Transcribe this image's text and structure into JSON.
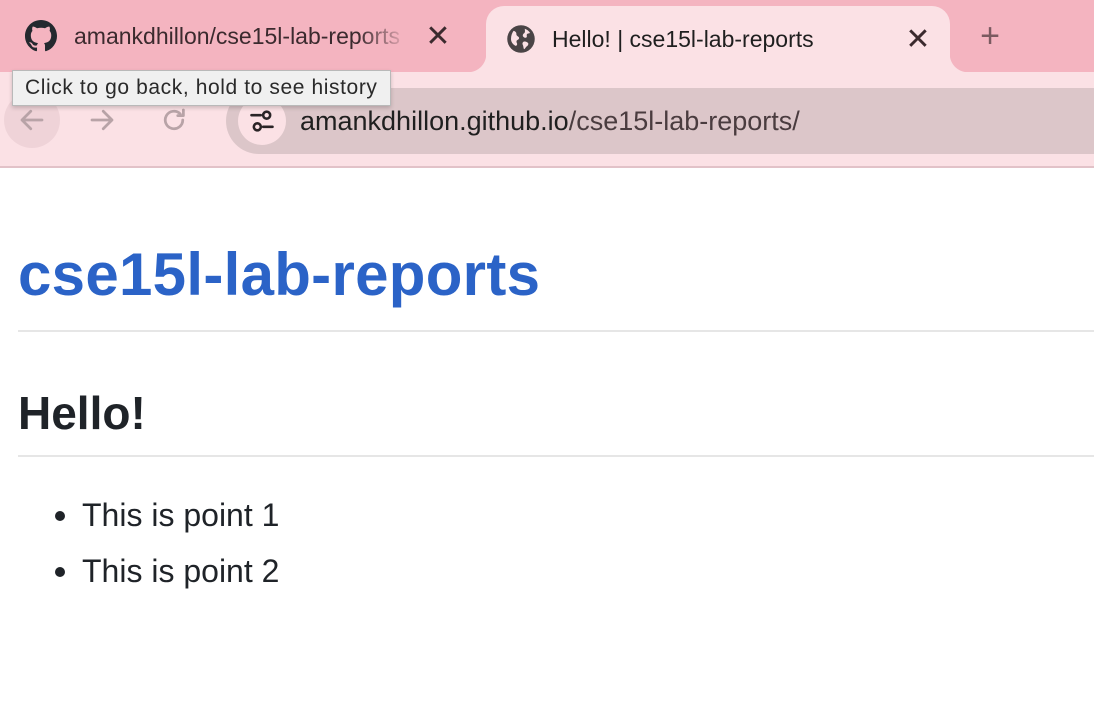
{
  "browser": {
    "tabs": [
      {
        "title": "amankdhillon/cse15l-lab-reports",
        "icon": "github-icon",
        "active": false
      },
      {
        "title": "Hello! | cse15l-lab-reports",
        "icon": "globe-icon",
        "active": true
      }
    ],
    "close_glyph": "✕",
    "new_tab_glyph": "+",
    "url_host": "amankdhillon.github.io",
    "url_path": "/cse15l-lab-reports/",
    "tooltip": "Click to go back, hold to see history"
  },
  "page": {
    "site_title": "cse15l-lab-reports",
    "heading": "Hello!",
    "points": [
      "This is point 1",
      "This is point 2"
    ]
  },
  "colors": {
    "tabstrip": "#f4b4c0",
    "toolbar": "#fbe1e5",
    "omnibox": "#dcc6c9",
    "link": "#2b63c7",
    "text": "#1f2328"
  }
}
